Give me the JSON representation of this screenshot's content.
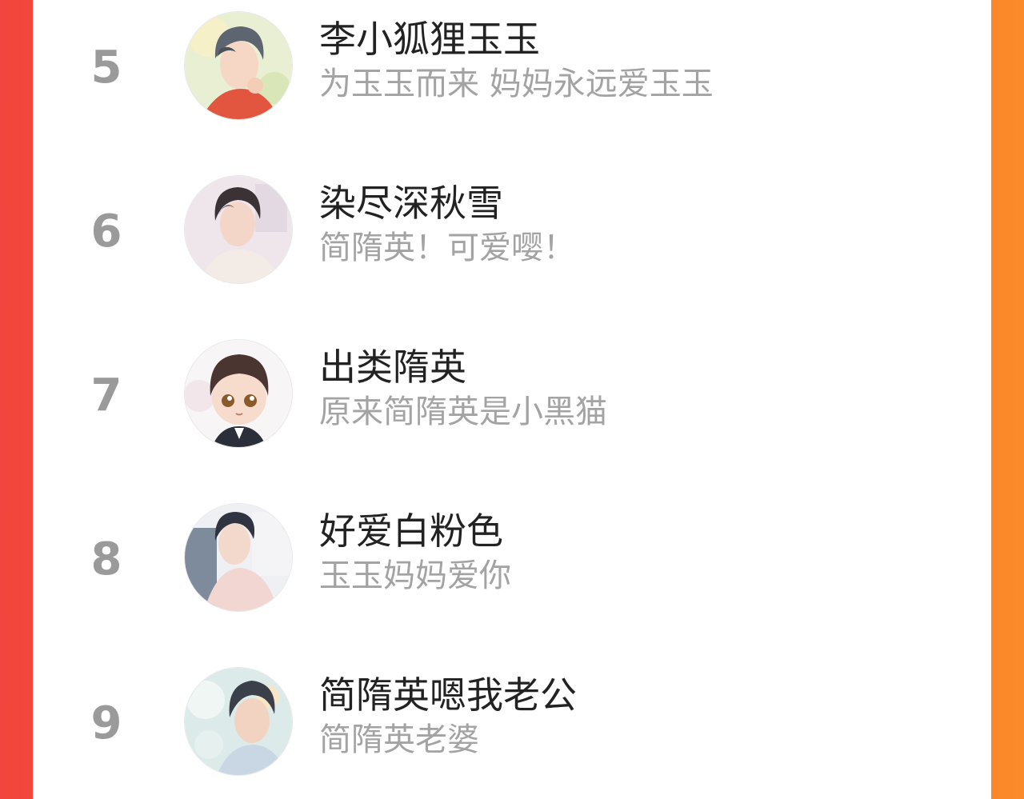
{
  "ranking": {
    "entries": [
      {
        "rank": "5",
        "name": "李小狐狸玉玉",
        "message": "为玉玉而来 妈妈永远爱玉玉",
        "avatar_icon": "avatar-anime-boy-ash-hair-icon"
      },
      {
        "rank": "6",
        "name": "染尽深秋雪",
        "message": "简隋英！可爱嘤！",
        "avatar_icon": "avatar-anime-man-dark-hair-icon"
      },
      {
        "rank": "7",
        "name": "出类隋英",
        "message": "原来简隋英是小黑猫",
        "avatar_icon": "avatar-chibi-boy-icon"
      },
      {
        "rank": "8",
        "name": "好爱白粉色",
        "message": "玉玉妈妈爱你",
        "avatar_icon": "avatar-anime-man-pink-shirt-icon"
      },
      {
        "rank": "9",
        "name": "简隋英嗯我老公",
        "message": "简隋英老婆",
        "avatar_icon": "avatar-anime-man-profile-icon"
      }
    ]
  },
  "colors": {
    "background_left": "#f2453d",
    "background_right": "#fb8a2a",
    "panel": "#ffffff",
    "rank_number": "#9a9a9a",
    "name_text": "#222222",
    "message_text": "#a3a3a3"
  }
}
